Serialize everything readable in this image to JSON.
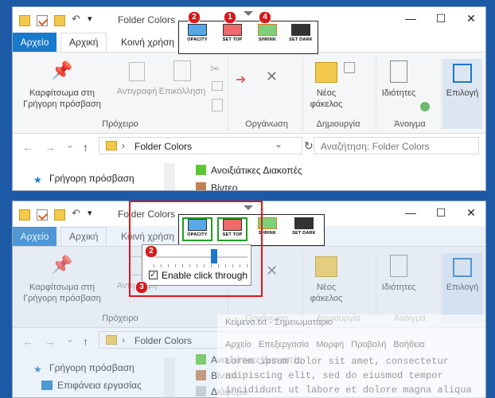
{
  "window": {
    "title": "Folder Colors",
    "minimize": "—",
    "maximize": "☐",
    "close": "✕",
    "down_arrow": "▾",
    "undo_glyph": "↶"
  },
  "tabs": {
    "file": "Αρχείο",
    "home": "Αρχική",
    "share": "Κοινή χρήση"
  },
  "ribbon": {
    "pin_label_1": "Καρφίτσωμα στη",
    "pin_label_2": "Γρήγορη πρόσβαση",
    "copy": "Αντιγραφή",
    "paste": "Επικόλληση",
    "group_clipboard": "Πρόχειρο",
    "group_organize": "Οργάνωση",
    "new_folder_1": "Νέος",
    "new_folder_2": "φάκελος",
    "group_new": "Δημιουργία",
    "properties": "Ιδιότητες",
    "group_open": "Άνοιγμα",
    "select": "Επιλογή"
  },
  "address": {
    "back": "←",
    "forward": "→",
    "dropdown": "⌄",
    "up": "↑",
    "sep": "›",
    "path": "Folder Colors",
    "refresh": "↻",
    "search_placeholder": "Αναζήτηση: Folder Colors"
  },
  "nav": {
    "quick_access": "Γρήγορη πρόσβαση",
    "desktop": "Επιφάνεια εργασίας"
  },
  "files": [
    {
      "name": "Ανοιξιάτικες Διακοπές",
      "color": "#5fc436"
    },
    {
      "name": "Βίντεο",
      "color": "#c27f52"
    },
    {
      "name": "Διάφορα",
      "color": "#c9c9c9"
    }
  ],
  "toolbar": {
    "opacity": "OPACITY",
    "set_top": "SET TOP",
    "shrink": "SHRINK",
    "set_dark": "SET DARK"
  },
  "badges": {
    "one": "1",
    "two": "2",
    "three": "3",
    "four": "4"
  },
  "popup": {
    "checkbox_mark": "✓",
    "click_through_label": "Enable click through",
    "opacity_fraction": 0.65
  },
  "overlay": {
    "title": "Κείμενο.txt - Σημειωματάριο",
    "menu": "Αρχείο Επεξεργασία Μορφή Προβολή Βοήθεια",
    "lines": [
      "Lorem ipsum dolor sit amet, consectetur",
      "adipiscing elit, sed do eiusmod tempor",
      "incididunt ut labore et dolore magna aliqua"
    ]
  },
  "colors": {
    "file_tab": "#1979ca",
    "badge_red": "#d7191c",
    "highlight_red": "#e3141b",
    "selected_green": "#1fa01f",
    "opacity_icon": "#5aa7e4",
    "settop_icon": "#ef6a6a",
    "shrink_icon": "#7bd17b",
    "dark_icon": "#333333"
  }
}
